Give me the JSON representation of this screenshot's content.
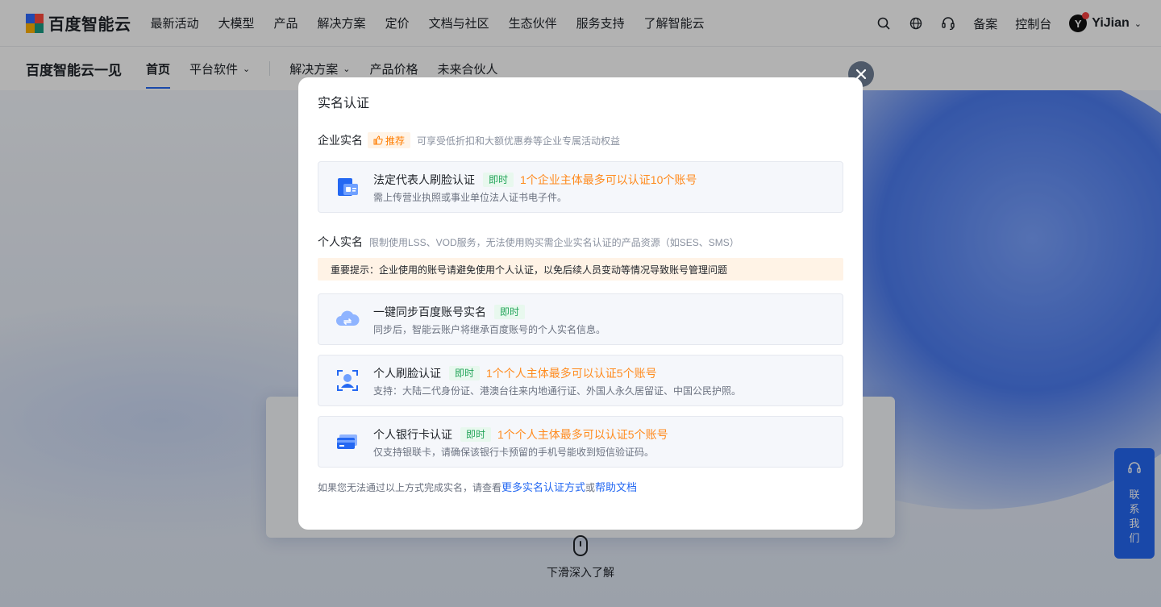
{
  "topnav": {
    "logo_text": "百度智能云",
    "items": [
      "最新活动",
      "大模型",
      "产品",
      "解决方案",
      "定价",
      "文档与社区",
      "生态伙伴",
      "服务支持",
      "了解智能云"
    ],
    "record_label": "备案",
    "console_label": "控制台",
    "user_initial": "Y",
    "user_name": "YiJian",
    "icons": [
      "search-icon",
      "globe-icon",
      "headset-icon"
    ]
  },
  "subnav": {
    "title": "百度智能云一见",
    "items": [
      "首页",
      "平台软件",
      "解决方案",
      "产品价格",
      "未来合伙人"
    ]
  },
  "hero": {
    "scroll_hint": "下滑深入了解"
  },
  "contact": {
    "label": "联系我们"
  },
  "modal": {
    "title": "实名认证",
    "enterprise": {
      "title": "企业实名",
      "tag": "推荐",
      "desc": "可享受低折扣和大额优惠券等企业专属活动权益",
      "card": {
        "title": "法定代表人刷脸认证",
        "tag": "即时",
        "limit": "1个企业主体最多可以认证10个账号",
        "desc": "需上传营业执照或事业单位法人证书电子件。"
      }
    },
    "personal": {
      "title": "个人实名",
      "desc": "限制使用LSS、VOD服务，无法使用购买需企业实名认证的产品资源（如SES、SMS）",
      "notice": "重要提示：企业使用的账号请避免使用个人认证，以免后续人员变动等情况导致账号管理问题",
      "cards": [
        {
          "title": "一键同步百度账号实名",
          "tag": "即时",
          "limit": "",
          "desc": "同步后，智能云账户将继承百度账号的个人实名信息。"
        },
        {
          "title": "个人刷脸认证",
          "tag": "即时",
          "limit": "1个个人主体最多可以认证5个账号",
          "desc": "支持：大陆二代身份证、港澳台往来内地通行证、外国人永久居留证、中国公民护照。"
        },
        {
          "title": "个人银行卡认证",
          "tag": "即时",
          "limit": "1个个人主体最多可以认证5个账号",
          "desc": "仅支持银联卡，请确保该银行卡预留的手机号能收到短信验证码。"
        }
      ]
    },
    "footer": {
      "prefix": "如果您无法通过以上方式完成实名，请查看",
      "link1": "更多实名认证方式",
      "middle": "或",
      "link2": "帮助文档"
    }
  },
  "colors": {
    "accent": "#2468f2",
    "orange": "#ff8b1f",
    "green": "#23a55a"
  }
}
